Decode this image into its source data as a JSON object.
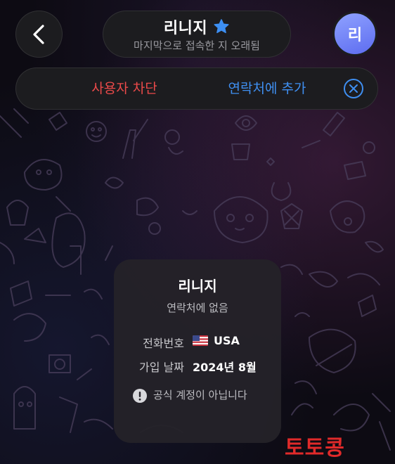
{
  "header": {
    "back_icon": "chevron-left-icon",
    "title": "리니지",
    "verified_icon": "star-badge-icon",
    "status": "마지막으로 접속한 지 오래됨",
    "avatar_initial": "리",
    "avatar_color": "#6f7ff6"
  },
  "action_bar": {
    "block_label": "사용자 차단",
    "block_color": "#eb4a4a",
    "add_contact_label": "연락처에 추가",
    "add_contact_color": "#3f8ff1",
    "dismiss_icon": "close-circle-icon"
  },
  "info_card": {
    "name": "리니지",
    "subtitle": "연락처에 없음",
    "phone_label": "전화번호",
    "phone_flag_icon": "us-flag-icon",
    "phone_value": "USA",
    "joined_label": "가입 날짜",
    "joined_value": "2024년 8월",
    "notice_icon": "exclamation-circle-icon",
    "notice_text": "공식 계정이 아닙니다"
  },
  "watermark": "토토콩"
}
